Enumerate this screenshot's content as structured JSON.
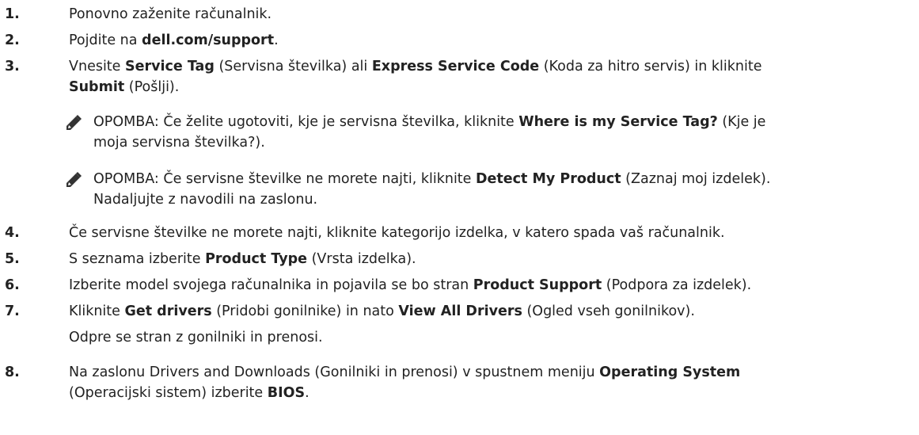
{
  "steps": [
    {
      "num": "1.",
      "lines": [
        [
          {
            "t": "Ponovno zaženite računalnik.",
            "b": false
          }
        ]
      ]
    },
    {
      "num": "2.",
      "lines": [
        [
          {
            "t": "Pojdite na ",
            "b": false
          },
          {
            "t": "dell.com/support",
            "b": true
          },
          {
            "t": ".",
            "b": false
          }
        ]
      ]
    },
    {
      "num": "3.",
      "lines": [
        [
          {
            "t": "Vnesite ",
            "b": false
          },
          {
            "t": "Service Tag",
            "b": true
          },
          {
            "t": " (Servisna številka) ali ",
            "b": false
          },
          {
            "t": "Express Service Code",
            "b": true
          },
          {
            "t": " (Koda za hitro servis) in kliknite",
            "b": false
          }
        ],
        [
          {
            "t": "Submit",
            "b": true
          },
          {
            "t": " (Pošlji).",
            "b": false
          }
        ]
      ],
      "notes": [
        {
          "lines": [
            [
              {
                "t": "OPOMBA:",
                "b": false
              },
              {
                "t": " Če želite ugotoviti, kje je servisna številka, kliknite ",
                "b": false
              },
              {
                "t": "Where is my Service Tag?",
                "b": true
              },
              {
                "t": " (Kje je",
                "b": false
              }
            ],
            [
              {
                "t": "moja servisna številka?).",
                "b": false
              }
            ]
          ]
        },
        {
          "lines": [
            [
              {
                "t": "OPOMBA:",
                "b": false
              },
              {
                "t": " Če servisne številke ne morete najti, kliknite ",
                "b": false
              },
              {
                "t": "Detect My Product",
                "b": true
              },
              {
                "t": " (Zaznaj moj izdelek).",
                "b": false
              }
            ],
            [
              {
                "t": "Nadaljujte z navodili na zaslonu.",
                "b": false
              }
            ]
          ]
        }
      ]
    },
    {
      "num": "4.",
      "lines": [
        [
          {
            "t": "Če servisne številke ne morete najti, kliknite kategorijo izdelka, v katero spada vaš računalnik.",
            "b": false
          }
        ]
      ]
    },
    {
      "num": "5.",
      "lines": [
        [
          {
            "t": "S seznama izberite ",
            "b": false
          },
          {
            "t": "Product Type",
            "b": true
          },
          {
            "t": " (Vrsta izdelka).",
            "b": false
          }
        ]
      ]
    },
    {
      "num": "6.",
      "lines": [
        [
          {
            "t": "Izberite model svojega računalnika in pojavila se bo stran ",
            "b": false
          },
          {
            "t": "Product Support",
            "b": true
          },
          {
            "t": " (Podpora za izdelek).",
            "b": false
          }
        ]
      ]
    },
    {
      "num": "7.",
      "lines": [
        [
          {
            "t": "Kliknite ",
            "b": false
          },
          {
            "t": "Get drivers",
            "b": true
          },
          {
            "t": " (Pridobi gonilnike) in nato ",
            "b": false
          },
          {
            "t": "View All Drivers",
            "b": true
          },
          {
            "t": " (Ogled vseh gonilnikov).",
            "b": false
          }
        ],
        [
          {
            "t": "Odpre se stran z gonilniki in prenosi.",
            "b": false
          }
        ]
      ]
    },
    {
      "num": "8.",
      "lines": [
        [
          {
            "t": "Na zaslonu Drivers and Downloads (Gonilniki in prenosi) v spustnem meniju ",
            "b": false
          },
          {
            "t": "Operating System",
            "b": true
          }
        ],
        [
          {
            "t": "(Operacijski sistem) izberite ",
            "b": false
          },
          {
            "t": "BIOS",
            "b": true
          },
          {
            "t": ".",
            "b": false
          }
        ]
      ]
    }
  ],
  "note_icon": "pencil-note-icon",
  "colors": {
    "text": "#222222",
    "icon": "#333333"
  }
}
